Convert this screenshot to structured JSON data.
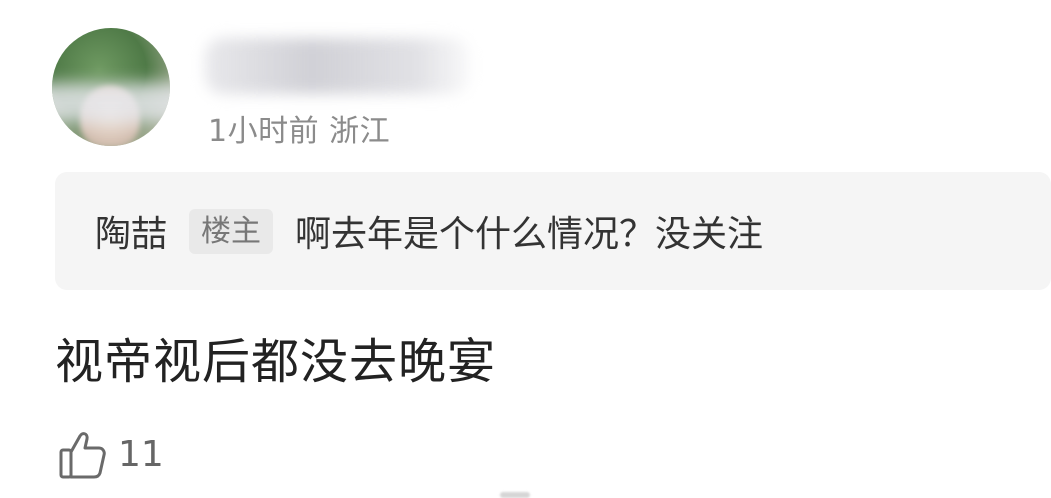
{
  "comment": {
    "timestamp": "1小时前",
    "location": "浙江",
    "text": "视帝视后都没去晚宴",
    "like_count": "11"
  },
  "reply": {
    "author": "陶喆",
    "badge": "楼主",
    "text": "啊去年是个什么情况？没关注"
  },
  "icons": {
    "like": "thumbs-up-icon"
  },
  "colors": {
    "meta_text": "#8b8b8b",
    "reply_background": "#f5f5f5",
    "badge_background": "#e9e9e9"
  }
}
